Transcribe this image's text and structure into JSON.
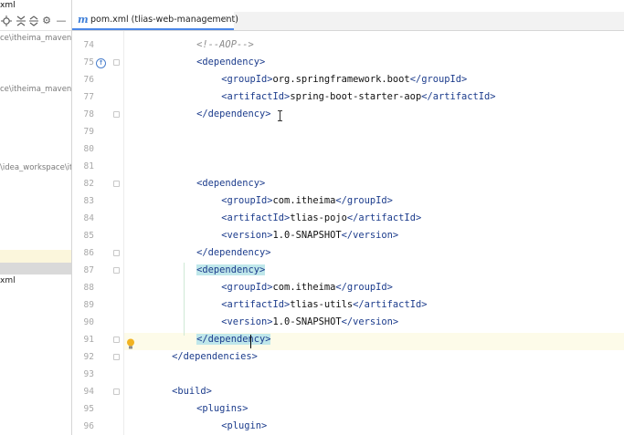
{
  "project_panel": {
    "top_label": "xml",
    "tree_rows": [
      "ce\\itheima_maven_",
      "ce\\itheima_maven_p",
      "\\idea_workspace\\it",
      "xml"
    ]
  },
  "tab": {
    "icon_letter": "m",
    "label": "pom.xml (tlias-web-management)",
    "close": "×"
  },
  "editor": {
    "lines": [
      {
        "num": "74",
        "indent": "        ",
        "parts": [
          {
            "t": "<!--AOP-->",
            "c": "cmt"
          }
        ]
      },
      {
        "num": "75",
        "indent": "        ",
        "parts": [
          {
            "t": "<",
            "c": "tag"
          },
          {
            "t": "dependency",
            "c": "tag"
          },
          {
            "t": ">",
            "c": "tag"
          }
        ]
      },
      {
        "num": "76",
        "indent": "            ",
        "parts": [
          {
            "t": "<groupId>",
            "c": "tag"
          },
          {
            "t": "org.springframework.boot",
            "c": "txt"
          },
          {
            "t": "</groupId>",
            "c": "tag"
          }
        ]
      },
      {
        "num": "77",
        "indent": "            ",
        "parts": [
          {
            "t": "<artifactId>",
            "c": "tag"
          },
          {
            "t": "spring-boot-starter-aop",
            "c": "txt"
          },
          {
            "t": "</artifactId>",
            "c": "tag"
          }
        ]
      },
      {
        "num": "78",
        "indent": "        ",
        "parts": [
          {
            "t": "</dependency>",
            "c": "tag"
          }
        ]
      },
      {
        "num": "79",
        "indent": "",
        "parts": []
      },
      {
        "num": "80",
        "indent": "",
        "parts": []
      },
      {
        "num": "81",
        "indent": "",
        "parts": []
      },
      {
        "num": "82",
        "indent": "        ",
        "parts": [
          {
            "t": "<dependency>",
            "c": "tag"
          }
        ]
      },
      {
        "num": "83",
        "indent": "            ",
        "parts": [
          {
            "t": "<groupId>",
            "c": "tag"
          },
          {
            "t": "com.itheima",
            "c": "txt"
          },
          {
            "t": "</groupId>",
            "c": "tag"
          }
        ]
      },
      {
        "num": "84",
        "indent": "            ",
        "parts": [
          {
            "t": "<artifactId>",
            "c": "tag"
          },
          {
            "t": "tlias-pojo",
            "c": "txt"
          },
          {
            "t": "</artifactId>",
            "c": "tag"
          }
        ]
      },
      {
        "num": "85",
        "indent": "            ",
        "parts": [
          {
            "t": "<version>",
            "c": "tag"
          },
          {
            "t": "1.0-SNAPSHOT",
            "c": "txt"
          },
          {
            "t": "</version>",
            "c": "tag"
          }
        ]
      },
      {
        "num": "86",
        "indent": "        ",
        "parts": [
          {
            "t": "</dependency>",
            "c": "tag"
          }
        ]
      },
      {
        "num": "87",
        "indent": "        ",
        "parts": [
          {
            "t": "<dependency>",
            "c": "tag hl-tag"
          }
        ]
      },
      {
        "num": "88",
        "indent": "            ",
        "parts": [
          {
            "t": "<groupId>",
            "c": "tag"
          },
          {
            "t": "com.itheima",
            "c": "txt"
          },
          {
            "t": "</groupId>",
            "c": "tag"
          }
        ]
      },
      {
        "num": "89",
        "indent": "            ",
        "parts": [
          {
            "t": "<artifactId>",
            "c": "tag"
          },
          {
            "t": "tlias-utils",
            "c": "txt"
          },
          {
            "t": "</artifactId>",
            "c": "tag"
          }
        ]
      },
      {
        "num": "90",
        "indent": "            ",
        "parts": [
          {
            "t": "<version>",
            "c": "tag"
          },
          {
            "t": "1.0-SNAPSHOT",
            "c": "txt"
          },
          {
            "t": "</version>",
            "c": "tag"
          }
        ]
      },
      {
        "num": "91",
        "indent": "        ",
        "parts": [
          {
            "t": "</dependency>",
            "c": "tag hl-tag"
          }
        ]
      },
      {
        "num": "92",
        "indent": "    ",
        "parts": [
          {
            "t": "</dependencies>",
            "c": "tag"
          }
        ]
      },
      {
        "num": "93",
        "indent": "",
        "parts": []
      },
      {
        "num": "94",
        "indent": "    ",
        "parts": [
          {
            "t": "<build>",
            "c": "tag"
          }
        ]
      },
      {
        "num": "95",
        "indent": "        ",
        "parts": [
          {
            "t": "<plugins>",
            "c": "tag"
          }
        ]
      },
      {
        "num": "96",
        "indent": "            ",
        "parts": [
          {
            "t": "<plugin>",
            "c": "tag"
          }
        ]
      }
    ]
  },
  "colors": {
    "tag": "#1c3c8c",
    "comment": "#8c8c8c",
    "text": "#111111",
    "match_highlight": "#bfe7ea",
    "current_line": "#fdfbe9",
    "tab_accent": "#4a86e8"
  },
  "icons": [
    "locate-icon",
    "expand-all-icon",
    "collapse-all-icon",
    "settings-gear-icon",
    "minimize-icon",
    "maven-file-icon",
    "run-gutter-icon",
    "intention-bulb-icon",
    "text-cursor-icon"
  ]
}
